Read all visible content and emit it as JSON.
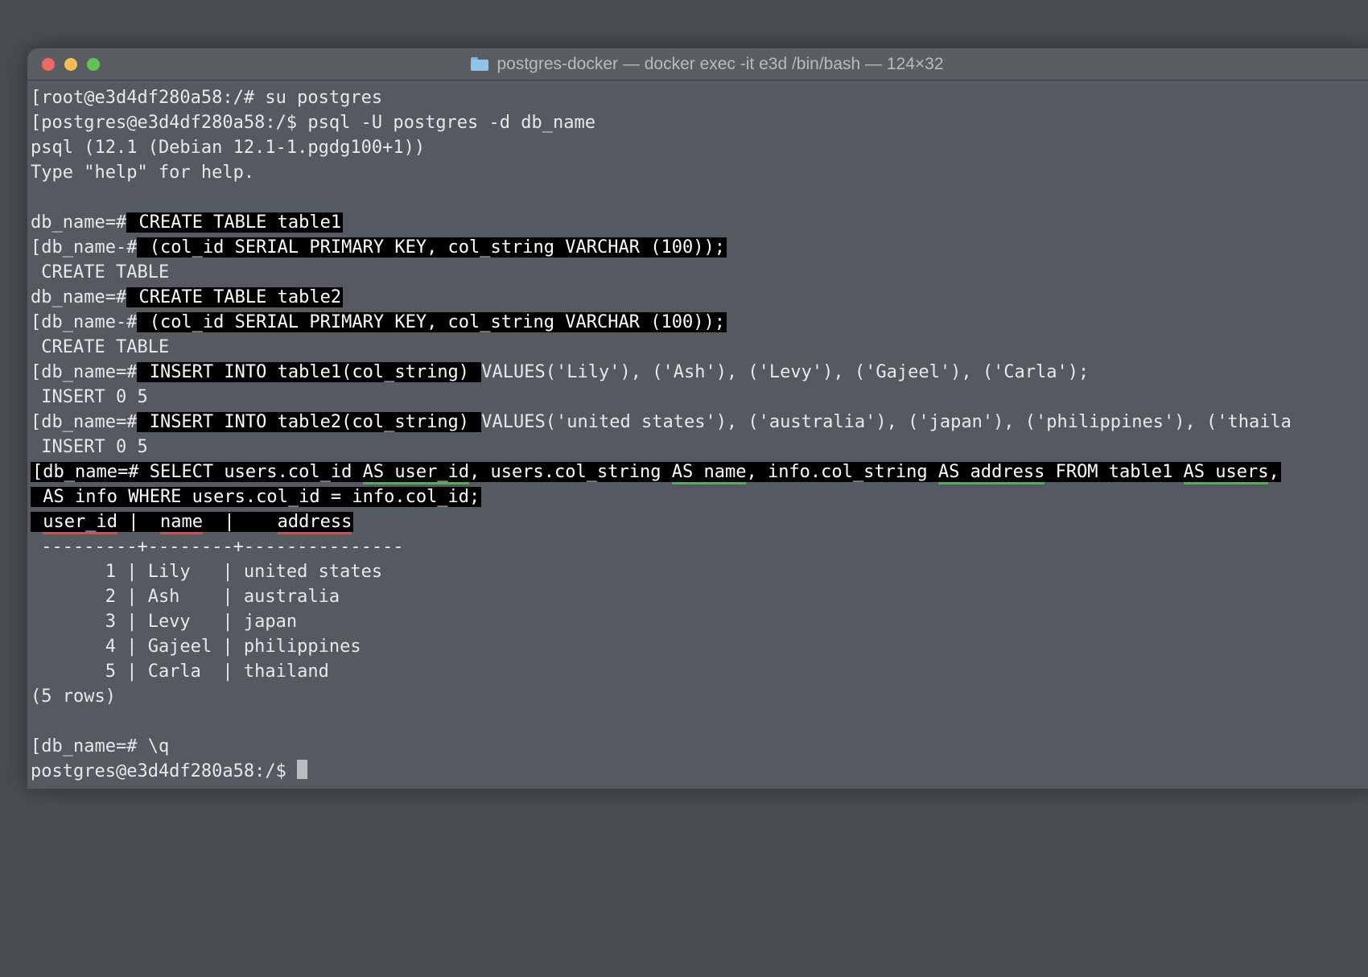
{
  "titlebar": {
    "title": "postgres-docker — docker exec -it e3d /bin/bash — 124×32"
  },
  "term": {
    "l1a": "[root@e3d4df280a58:/# su postgres",
    "l2a": "[postgres@e3d4df280a58:/$ psql -U postgres -d db_name",
    "l3": "psql (12.1 (Debian 12.1-1.pgdg100+1))",
    "l4": "Type \"help\" for help.",
    "l5p": "db_name=#",
    "l5h": " CREATE TABLE table1",
    "l6p": "[db_name-#",
    "l6h": " (col_id SERIAL PRIMARY KEY, col_string VARCHAR (100));",
    "l7": " CREATE TABLE",
    "l8p": "db_name=#",
    "l8h": " CREATE TABLE table2",
    "l9p": "[db_name-#",
    "l9h": " (col_id SERIAL PRIMARY KEY, col_string VARCHAR (100));",
    "l10": " CREATE TABLE",
    "l11p": "[db_name=#",
    "l11h": " INSERT INTO table1(col_string) ",
    "l11t": "VALUES('Lily'), ('Ash'), ('Levy'), ('Gajeel'), ('Carla');",
    "l12": " INSERT 0 5",
    "l13p": "[db_name=#",
    "l13h": " INSERT INTO table2(col_string) ",
    "l13t": "VALUES('united states'), ('australia'), ('japan'), ('philippines'), ('thaila",
    "l14": " INSERT 0 5",
    "sel_p": "[db_name=# ",
    "sel_1": "SELECT users.col_id ",
    "sel_as1": "AS user_id",
    "sel_2": ", users.col_string ",
    "sel_as2": "AS name",
    "sel_3": ", info.col_string ",
    "sel_as3": "AS address",
    "sel_4": " FROM table1 ",
    "sel_as4": "AS users",
    "sel_5": ",",
    "sel2_1": " AS info WHERE users.col_id = info.col_id;",
    "hdr_sp1": " ",
    "hdr_c1": "user_id",
    "hdr_mid1": " |  ",
    "hdr_c2": "name",
    "hdr_mid2": "  |    ",
    "hdr_c3": "address",
    "hdr_ln": " ---------+--------+---------------",
    "row1": "       1 | Lily   | united states",
    "row2": "       2 | Ash    | australia",
    "row3": "       3 | Levy   | japan",
    "row4": "       4 | Gajeel | philippines",
    "row5": "       5 | Carla  | thailand",
    "rows": "(5 rows)",
    "quitp": "[db_name=# ",
    "quitc": "\\q",
    "lastp": "postgres@e3d4df280a58:/$ "
  }
}
